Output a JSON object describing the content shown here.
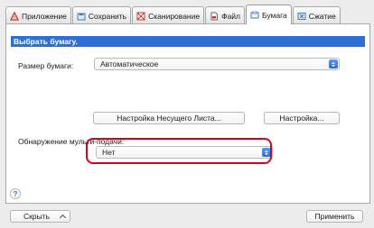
{
  "tabs": [
    {
      "label": "Приложение",
      "icon": "application-icon"
    },
    {
      "label": "Сохранить",
      "icon": "save-icon"
    },
    {
      "label": "Сканирование",
      "icon": "scan-icon"
    },
    {
      "label": "Файл",
      "icon": "file-icon"
    },
    {
      "label": "Бумага",
      "icon": "paper-icon",
      "active": true
    },
    {
      "label": "Сжатие",
      "icon": "compression-icon"
    }
  ],
  "section": {
    "title": "Выбрать бумагу."
  },
  "paper_size": {
    "label": "Размер бумаги:",
    "value": "Автоматическое"
  },
  "buttons": {
    "carrier_sheet": "Настройка Несущего Листа...",
    "settings": "Настройка..."
  },
  "multifeed": {
    "label": "Обнаружение мульти-подачи:",
    "value": "Нет"
  },
  "help": {
    "label": "?"
  },
  "footer": {
    "hide_label": "Скрыть",
    "apply_label": "Применить"
  },
  "colors": {
    "accent": "#2f6fd2",
    "highlight": "#d9001b"
  }
}
